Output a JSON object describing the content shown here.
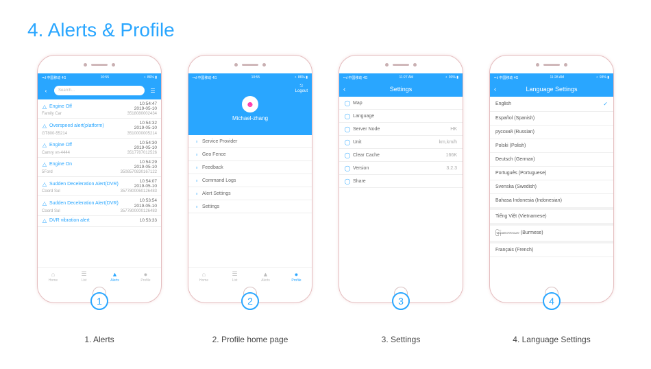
{
  "title": "4. Alerts & Profile",
  "status": {
    "left": "••ıl 中国移动 4G",
    "time1": "10:55",
    "right": "⚬ 86% ▮",
    "left2": "••ıl 中国移动 4G",
    "time2": "11:27 AM",
    "right2": "⚬ 93% ▮",
    "time3": "11:28 AM",
    "right3": "⚬ 93% ▮"
  },
  "tabs": [
    "Home",
    "List",
    "Alerts",
    "Profile"
  ],
  "phones": [
    {
      "num": "1",
      "caption": "1. Alerts"
    },
    {
      "num": "2",
      "caption": "2. Profile home page"
    },
    {
      "num": "3",
      "caption": "3. Settings"
    },
    {
      "num": "4",
      "caption": "4. Language Settings"
    }
  ],
  "alerts": {
    "search_placeholder": "Search...",
    "items": [
      {
        "title": "Engine Off",
        "time": "10:54:47",
        "date": "2019-05-10",
        "device": "Family Car",
        "code": "3518080002434"
      },
      {
        "title": "Overspeed alert(platform)",
        "time": "10:54:32",
        "date": "2019-05-10",
        "device": "GT800-55214",
        "code": "3510000005214"
      },
      {
        "title": "Engine Off",
        "time": "10:54:30",
        "date": "2019-05-10",
        "device": "Camry vn-4444",
        "code": "3517787012526"
      },
      {
        "title": "Engine On",
        "time": "10:54:29",
        "date": "2019-05-10",
        "device": "5Ford",
        "code": "3508570830167122"
      },
      {
        "title": "Sudden Deceleration Alert(DVR)",
        "time": "10:54:07",
        "date": "2019-05-10",
        "device": "Coord Sul",
        "code": "3577800060126483"
      },
      {
        "title": "Sudden Deceleration Alert(DVR)",
        "time": "10:53:54",
        "date": "2019-05-10",
        "device": "Coord Sul",
        "code": "3577800000126483"
      },
      {
        "title": "DVR vibration alert",
        "time": "10:53:33",
        "date": "",
        "device": "",
        "code": ""
      }
    ]
  },
  "profile": {
    "logout": "Logout",
    "username": "Michael-zhang",
    "items": [
      {
        "icon": "card-icon",
        "label": "Service Provider"
      },
      {
        "icon": "fence-icon",
        "label": "Geo Fence"
      },
      {
        "icon": "feedback-icon",
        "label": "Feedback"
      },
      {
        "icon": "log-icon",
        "label": "Command Logs"
      },
      {
        "icon": "alert-icon",
        "label": "Alert Settings"
      },
      {
        "icon": "gear-icon",
        "label": "Settings"
      }
    ]
  },
  "settings": {
    "title": "Settings",
    "items": [
      {
        "icon": "map-icon",
        "label": "Map",
        "value": ""
      },
      {
        "icon": "globe-icon",
        "label": "Language",
        "value": ""
      },
      {
        "icon": "server-icon",
        "label": "Server Node",
        "value": "HK"
      },
      {
        "icon": "unit-icon",
        "label": "Unit",
        "value": "km,km/h"
      },
      {
        "icon": "cache-icon",
        "label": "Clear Cache",
        "value": "166K"
      },
      {
        "icon": "version-icon",
        "label": "Version",
        "value": "3.2.3"
      },
      {
        "icon": "share-icon",
        "label": "Share",
        "value": ""
      }
    ]
  },
  "language": {
    "title": "Language Settings",
    "items": [
      {
        "label": "English",
        "selected": true
      },
      {
        "label": "Español (Spanish)"
      },
      {
        "label": "русский (Russian)"
      },
      {
        "label": "Polski (Polish)"
      },
      {
        "label": "Deutsch (German)"
      },
      {
        "label": "Português (Portuguese)"
      },
      {
        "label": "Svenska (Swedish)"
      },
      {
        "label": "Bahasa Indonesia (Indonesian)",
        "sep": true
      },
      {
        "label": "Tiếng Việt (Vietnamese)",
        "sep": true
      },
      {
        "label": "မြန်မာဘာသာ (Burmese)",
        "sep": true
      },
      {
        "label": "Français (French)"
      }
    ]
  }
}
